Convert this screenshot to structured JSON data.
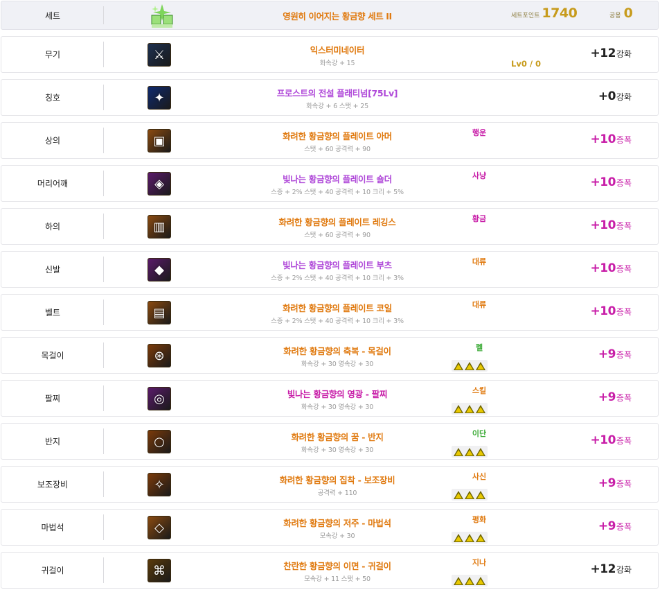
{
  "colors": {
    "orange": "#e07a10",
    "purple": "#b04ad9",
    "magenta": "#c81ea8",
    "gold": "#c79b1c",
    "green": "#3aaa35",
    "dark": "#222222"
  },
  "header": {
    "slot": "세트",
    "name": "영원히 이어지는 황금향 세트 II",
    "set_point_label": "세트포인트",
    "set_point_value": "1740",
    "common_label": "공용",
    "common_value": "0",
    "icon": "set-gem-icon"
  },
  "rows": [
    {
      "slot": "무기",
      "name": "익스터미네이터",
      "name_color": "#e07a10",
      "stats": "화속강 + 15",
      "emblem": "",
      "emblem_color": "",
      "triangles": false,
      "level": "Lv0 / 0",
      "plus": "+12",
      "suffix": "강화",
      "plus_color": "#222222",
      "icon": "sword-icon",
      "icon_bg": "#1d3050",
      "icon_glyph": "⚔"
    },
    {
      "slot": "칭호",
      "name": "프로스트의 전설 플래티넘[75Lv]",
      "name_color": "#b04ad9",
      "stats": "화속강 + 6 스탯 + 25",
      "emblem": "",
      "emblem_color": "",
      "triangles": false,
      "level": "",
      "plus": "+0",
      "suffix": "강화",
      "plus_color": "#222222",
      "icon": "title-crystal-icon",
      "icon_bg": "#0f2a6e",
      "icon_glyph": "✦"
    },
    {
      "slot": "상의",
      "name": "화려한 황금향의 플레이트 아머",
      "name_color": "#e07a10",
      "stats": "스탯 + 60 공격력 + 90",
      "emblem": "행운",
      "emblem_color": "#c81ea8",
      "triangles": false,
      "level": "",
      "plus": "+10",
      "suffix": "증폭",
      "plus_color": "#c81ea8",
      "icon": "armor-icon",
      "icon_bg": "#8a4a10",
      "icon_glyph": "▣"
    },
    {
      "slot": "머리어깨",
      "name": "빛나는 황금향의 플레이트 숄더",
      "name_color": "#b04ad9",
      "stats": "스증 + 2% 스탯 + 40 공격력 + 10 크리 + 5%",
      "emblem": "사냥",
      "emblem_color": "#c81ea8",
      "triangles": false,
      "level": "",
      "plus": "+10",
      "suffix": "증폭",
      "plus_color": "#c81ea8",
      "icon": "shoulder-icon",
      "icon_bg": "#5a1a6a",
      "icon_glyph": "◈"
    },
    {
      "slot": "하의",
      "name": "화려한 황금향의 플레이트 레깅스",
      "name_color": "#e07a10",
      "stats": "스탯 + 60 공격력 + 90",
      "emblem": "황금",
      "emblem_color": "#c81ea8",
      "triangles": false,
      "level": "",
      "plus": "+10",
      "suffix": "증폭",
      "plus_color": "#c81ea8",
      "icon": "leggings-icon",
      "icon_bg": "#8a4a10",
      "icon_glyph": "▥"
    },
    {
      "slot": "신발",
      "name": "빛나는 황금향의 플레이트 부츠",
      "name_color": "#b04ad9",
      "stats": "스증 + 2% 스탯 + 40 공격력 + 10 크리 + 3%",
      "emblem": "대류",
      "emblem_color": "#e07a10",
      "triangles": false,
      "level": "",
      "plus": "+10",
      "suffix": "증폭",
      "plus_color": "#c81ea8",
      "icon": "boots-icon",
      "icon_bg": "#5a1a6a",
      "icon_glyph": "◆"
    },
    {
      "slot": "벨트",
      "name": "화려한 황금향의 플레이트 코일",
      "name_color": "#e07a10",
      "stats": "스증 + 2% 스탯 + 40 공격력 + 10 크리 + 3%",
      "emblem": "대류",
      "emblem_color": "#e07a10",
      "triangles": false,
      "level": "",
      "plus": "+10",
      "suffix": "증폭",
      "plus_color": "#c81ea8",
      "icon": "belt-icon",
      "icon_bg": "#8a4a10",
      "icon_glyph": "▤"
    },
    {
      "slot": "목걸이",
      "name": "화려한 황금향의 축복 - 목걸이",
      "name_color": "#e07a10",
      "stats": "화속강 + 30 영속강 + 30",
      "emblem": "펠",
      "emblem_color": "#3aaa35",
      "triangles": true,
      "level": "",
      "plus": "+9",
      "suffix": "증폭",
      "plus_color": "#c81ea8",
      "icon": "necklace-icon",
      "icon_bg": "#7a3a0a",
      "icon_glyph": "⊛"
    },
    {
      "slot": "팔찌",
      "name": "빛나는 황금향의 영광 - 팔찌",
      "name_color": "#c81ea8",
      "stats": "화속강 + 30 영속강 + 30",
      "emblem": "스킬",
      "emblem_color": "#e07a10",
      "triangles": true,
      "level": "",
      "plus": "+9",
      "suffix": "증폭",
      "plus_color": "#c81ea8",
      "icon": "bracelet-icon",
      "icon_bg": "#5a1a6a",
      "icon_glyph": "◎"
    },
    {
      "slot": "반지",
      "name": "화려한 황금향의 꿈 - 반지",
      "name_color": "#e07a10",
      "stats": "화속강 + 30 영속강 + 30",
      "emblem": "이단",
      "emblem_color": "#3aaa35",
      "triangles": true,
      "level": "",
      "plus": "+10",
      "suffix": "증폭",
      "plus_color": "#c81ea8",
      "icon": "ring-icon",
      "icon_bg": "#7a3a0a",
      "icon_glyph": "○"
    },
    {
      "slot": "보조장비",
      "name": "화려한 황금향의 집착 - 보조장비",
      "name_color": "#e07a10",
      "stats": "공격력 + 110",
      "emblem": "사신",
      "emblem_color": "#e07a10",
      "triangles": true,
      "level": "",
      "plus": "+9",
      "suffix": "증폭",
      "plus_color": "#c81ea8",
      "icon": "sub-equipment-icon",
      "icon_bg": "#7a3a0a",
      "icon_glyph": "✧"
    },
    {
      "slot": "마법석",
      "name": "화려한 황금향의 저주 - 마법석",
      "name_color": "#e07a10",
      "stats": "모속강 + 30",
      "emblem": "평화",
      "emblem_color": "#e07a10",
      "triangles": true,
      "level": "",
      "plus": "+9",
      "suffix": "증폭",
      "plus_color": "#c81ea8",
      "icon": "magic-stone-icon",
      "icon_bg": "#8a4a10",
      "icon_glyph": "◇"
    },
    {
      "slot": "귀걸이",
      "name": "찬란한 황금향의 이면 - 귀걸이",
      "name_color": "#e07a10",
      "stats": "모속강 + 11 스탯 + 50",
      "emblem": "지나",
      "emblem_color": "#e07a10",
      "triangles": true,
      "level": "",
      "plus": "+12",
      "suffix": "강화",
      "plus_color": "#222222",
      "icon": "earring-icon",
      "icon_bg": "#5a3a0a",
      "icon_glyph": "⌘"
    }
  ]
}
